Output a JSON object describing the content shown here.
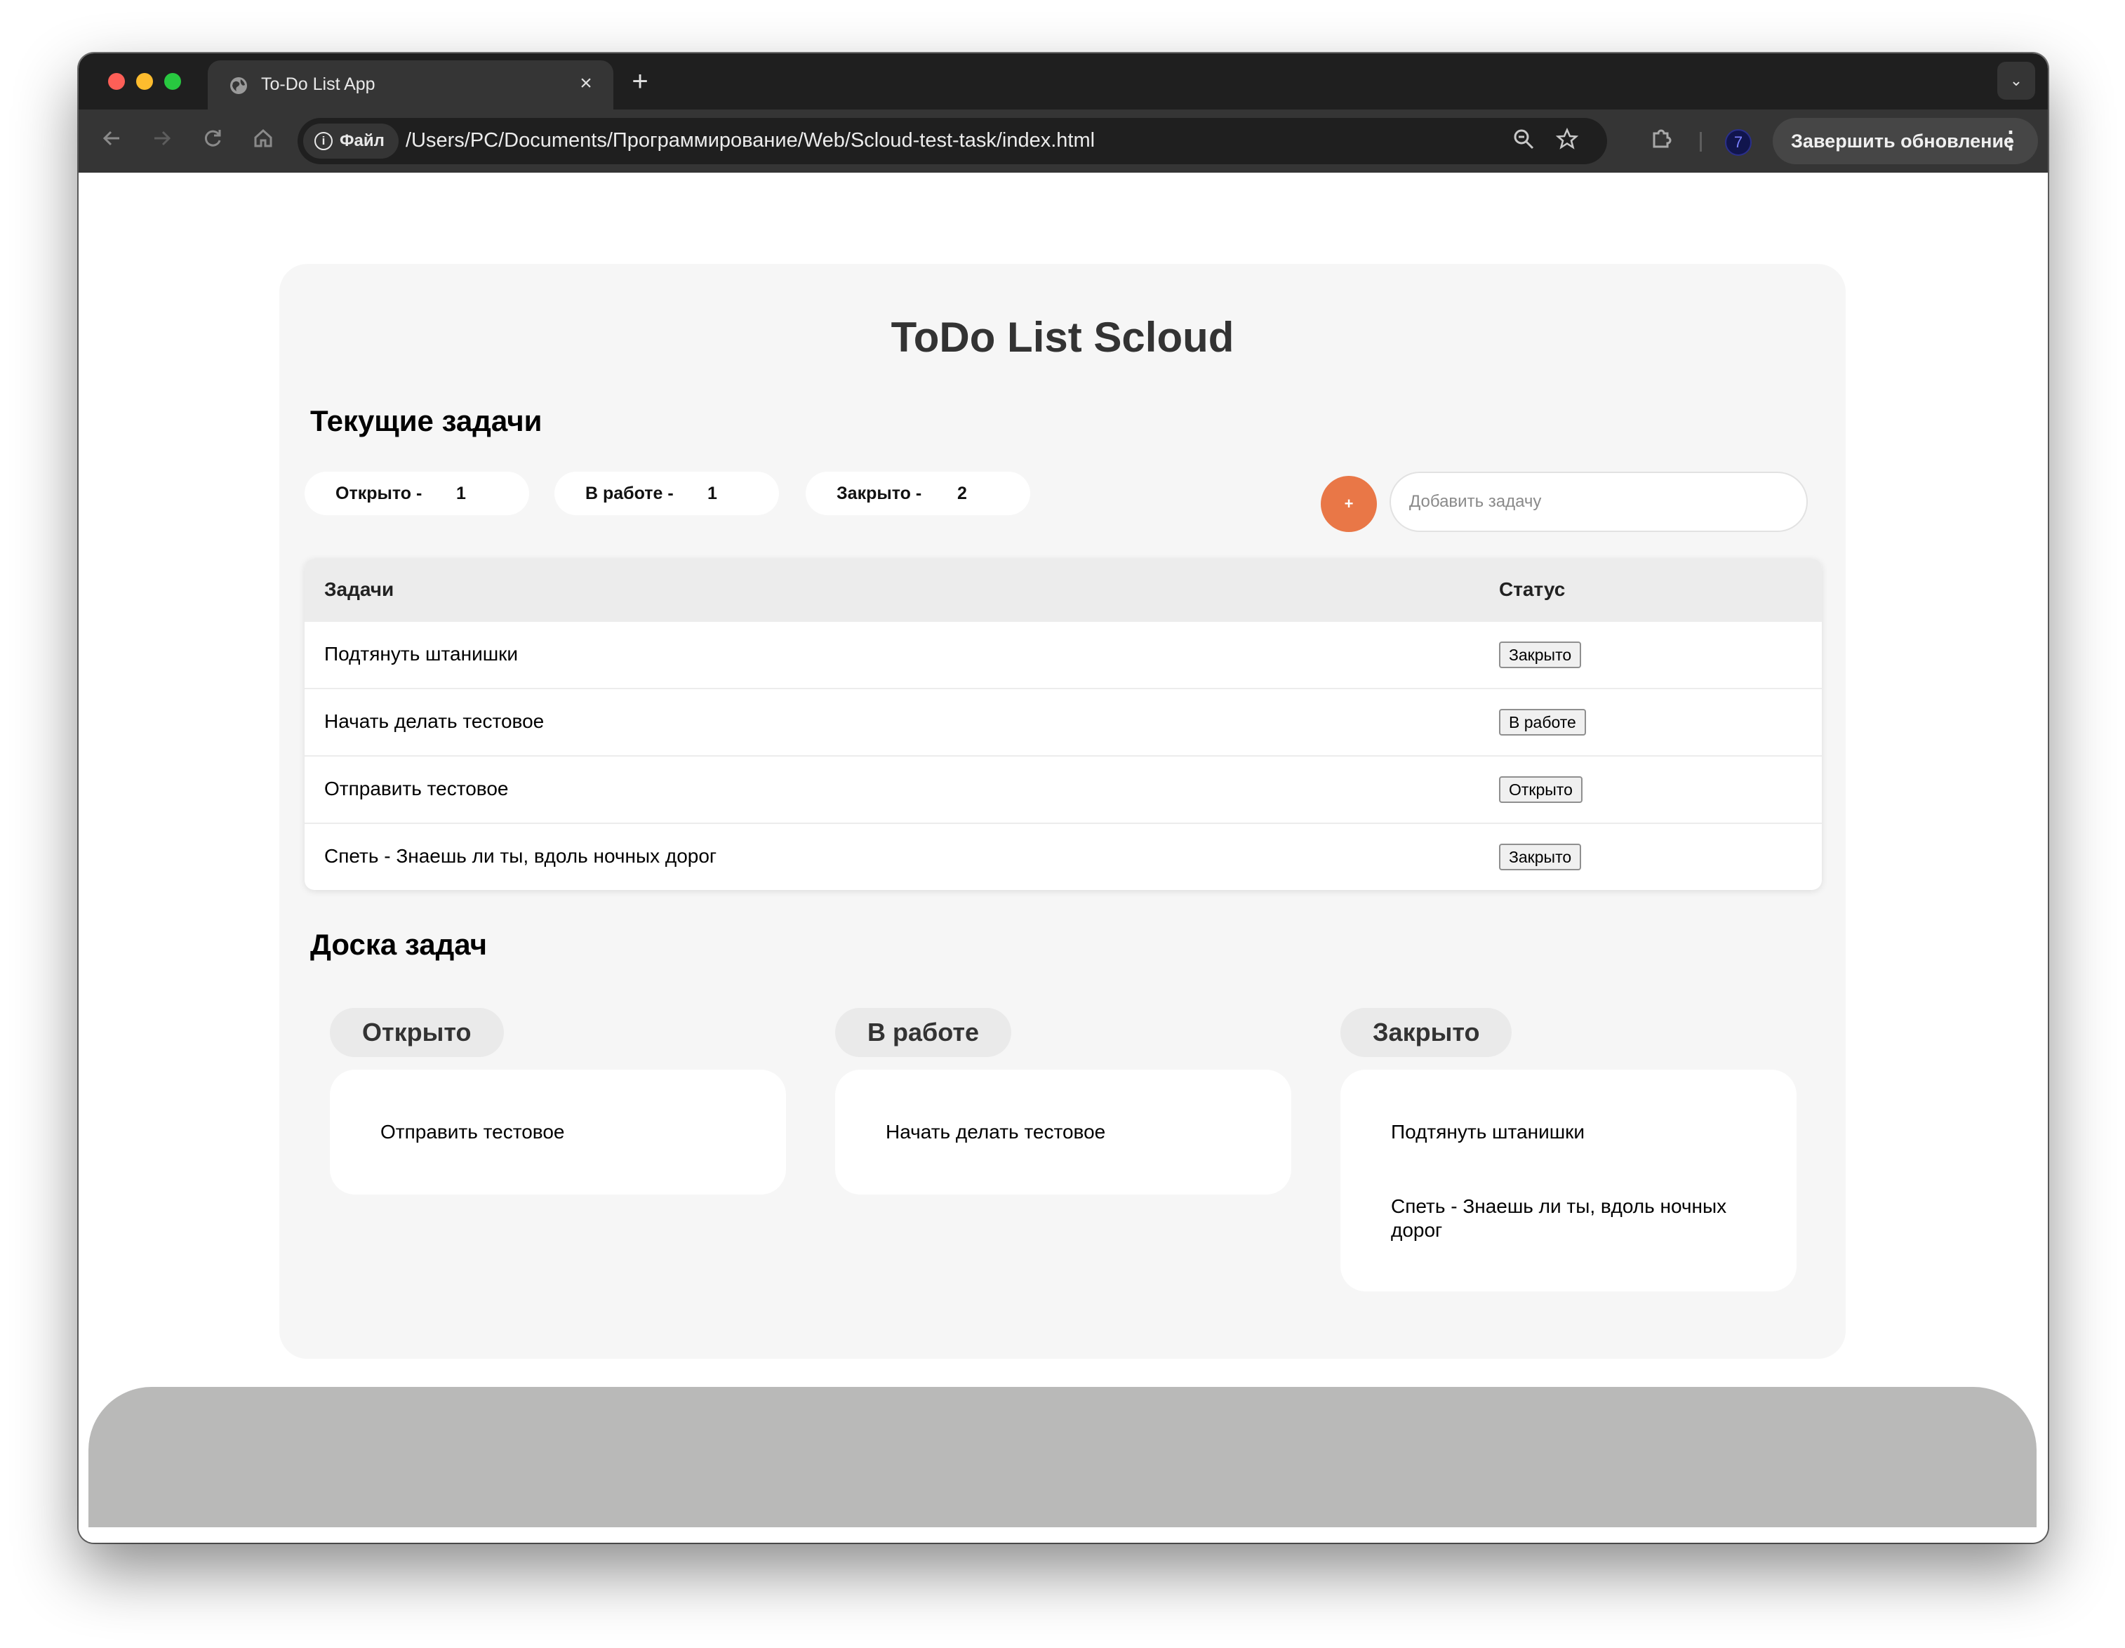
{
  "browser": {
    "tab_title": "To-Do List App",
    "tab_close": "×",
    "new_tab": "+",
    "tab_menu": "⌄",
    "site_chip": "Файл",
    "url": "/Users/PC/Documents/Программирование/Web/Scloud-test-task/index.html",
    "profile_letter": "7",
    "update_label": "Завершить обновление",
    "menu_dots": "⋮"
  },
  "app": {
    "title": "ToDo List Scloud",
    "current_title": "Текущие задачи",
    "counters": [
      {
        "label": "Открыто -",
        "count": "1"
      },
      {
        "label": "В работе -",
        "count": "1"
      },
      {
        "label": "Закрыто -",
        "count": "2"
      }
    ],
    "add_button": "+",
    "add_placeholder": "Добавить задачу",
    "table": {
      "headers": {
        "task": "Задачи",
        "status": "Статус"
      },
      "rows": [
        {
          "task": "Подтянуть штанишки",
          "status": "Закрыто"
        },
        {
          "task": "Начать делать тестовое",
          "status": "В работе"
        },
        {
          "task": "Отправить тестовое",
          "status": "Открыто"
        },
        {
          "task": "Спеть - Знаешь ли ты, вдоль ночных дорог",
          "status": "Закрыто"
        }
      ]
    },
    "board_title": "Доска задач",
    "board": [
      {
        "label": "Открыто",
        "items": [
          "Отправить тестовое"
        ]
      },
      {
        "label": "В работе",
        "items": [
          "Начать делать тестовое"
        ]
      },
      {
        "label": "Закрыто",
        "items": [
          "Подтянуть штанишки",
          "Спеть - Знаешь ли ты, вдоль ночных дорог"
        ]
      }
    ]
  },
  "colors": {
    "accent": "#e97747",
    "panel": "#f6f6f6"
  },
  "icons": [
    "globe-icon",
    "close-icon",
    "plus-icon",
    "chevron-down-icon",
    "back-icon",
    "forward-icon",
    "reload-icon",
    "home-icon",
    "info-icon",
    "zoom-icon",
    "star-icon",
    "extension-icon",
    "more-icon"
  ]
}
